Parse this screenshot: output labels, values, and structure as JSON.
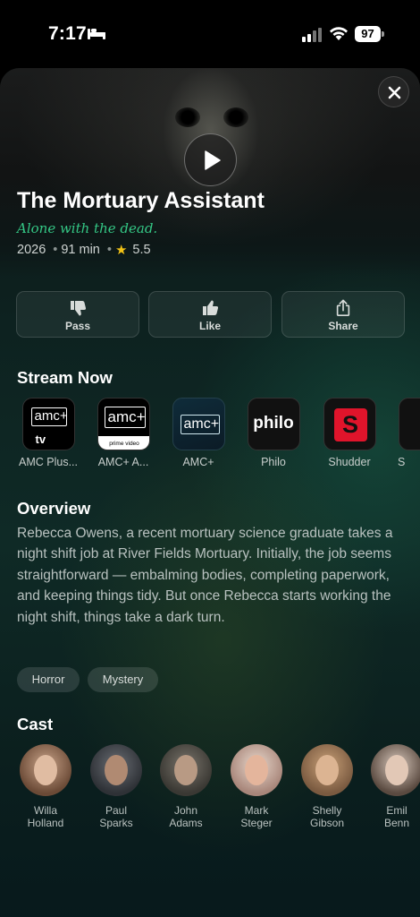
{
  "status_bar": {
    "time": "7:17",
    "battery": "97"
  },
  "movie": {
    "title": "The Mortuary Assistant",
    "tagline": "Alone with the dead.",
    "year": "2026",
    "runtime": "91 min",
    "rating": "5.5"
  },
  "actions": [
    {
      "label": "Pass",
      "icon": "thumbs-down-icon"
    },
    {
      "label": "Like",
      "icon": "thumbs-up-icon"
    },
    {
      "label": "Share",
      "icon": "share-icon"
    }
  ],
  "stream": {
    "title": "Stream Now",
    "providers": [
      {
        "label": "AMC Plus...",
        "logo_text": "amc+",
        "sub_text": "tv"
      },
      {
        "label": "AMC+ A...",
        "logo_text": "amc+",
        "sub_text": "prime video"
      },
      {
        "label": "AMC+",
        "logo_text": "amc+"
      },
      {
        "label": "Philo",
        "logo_text": "philo"
      },
      {
        "label": "Shudder",
        "logo_text": "S"
      },
      {
        "label": "S"
      }
    ]
  },
  "overview": {
    "title": "Overview",
    "text": "Rebecca Owens, a recent mortuary science graduate takes a night shift job at River Fields Mortuary. Initially, the job seems straightforward — embalming bodies, completing paperwork, and keeping things tidy. But once Rebecca starts working the night shift, things take a dark turn."
  },
  "genres": [
    "Horror",
    "Mystery"
  ],
  "cast": {
    "title": "Cast",
    "members": [
      {
        "first": "Willa",
        "last": "Holland"
      },
      {
        "first": "Paul",
        "last": "Sparks"
      },
      {
        "first": "John",
        "last": "Adams"
      },
      {
        "first": "Mark",
        "last": "Steger"
      },
      {
        "first": "Shelly",
        "last": "Gibson"
      },
      {
        "first": "Emil",
        "last": "Benn"
      }
    ]
  },
  "colors": {
    "accent": "#34c785",
    "star": "#f3c316",
    "shudder": "#e0142b"
  }
}
